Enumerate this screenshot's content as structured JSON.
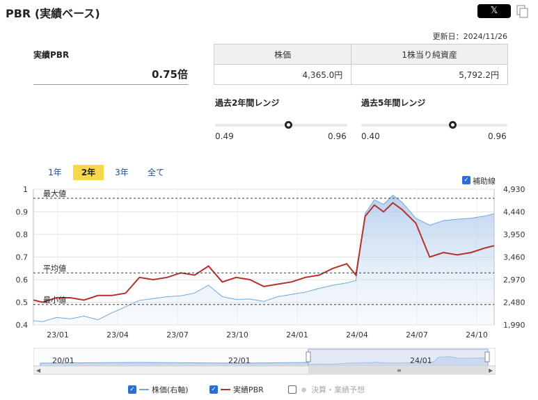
{
  "header": {
    "title": "PBR (実績ベース)",
    "share_label": "𝕏"
  },
  "updated": "更新日：2024/11/26",
  "pbr": {
    "label": "実績PBR",
    "value": "0.75倍"
  },
  "price_table": {
    "headers": [
      "株価",
      "1株当り純資産"
    ],
    "values": [
      "4,365.0円",
      "5,792.2円"
    ]
  },
  "ranges": [
    {
      "title": "過去2年間レンジ",
      "min": "0.49",
      "max": "0.96",
      "position": 0.55
    },
    {
      "title": "過去5年間レンジ",
      "min": "0.40",
      "max": "0.96",
      "position": 0.625
    }
  ],
  "tabs": [
    "1年",
    "2年",
    "3年",
    "全て"
  ],
  "active_tab": "2年",
  "aux_lines": {
    "label": "補助線",
    "checked": true
  },
  "ref_lines": {
    "max_label": "最大値",
    "avg_label": "平均値",
    "min_label": "最小値"
  },
  "navigator": {
    "labels": [
      "20/01",
      "22/01",
      "24/01"
    ]
  },
  "legend": [
    {
      "label": "株価(右軸)",
      "checked": true,
      "color": "#6ea8dc"
    },
    {
      "label": "実績PBR",
      "checked": true,
      "color": "#b5302a"
    },
    {
      "label": "決算・業績予想",
      "checked": false,
      "color": "#bbbbbb"
    }
  ],
  "chart_data": {
    "type": "line",
    "x_ticks": [
      "23/01",
      "23/04",
      "23/07",
      "23/10",
      "24/01",
      "24/04",
      "24/07",
      "24/10"
    ],
    "y_left_ticks": [
      "0.4",
      "0.5",
      "0.6",
      "0.7",
      "0.8",
      "0.9",
      "1"
    ],
    "y_right_ticks": [
      "1,990",
      "2,480",
      "2,970",
      "3,460",
      "3,950",
      "4,440",
      "4,930"
    ],
    "ylim_left": [
      0.4,
      1.0
    ],
    "ylim_right": [
      1990,
      4930
    ],
    "reference_lines": {
      "max": 0.96,
      "avg": 0.63,
      "min": 0.49
    },
    "series": [
      {
        "name": "実績PBR",
        "axis": "left",
        "color": "#b5302a",
        "x": [
          0,
          2,
          5,
          8,
          11,
          14,
          17,
          20,
          23,
          26,
          29,
          32,
          35,
          38,
          41,
          44,
          47,
          50,
          53,
          56,
          59,
          62,
          65,
          68,
          70,
          72,
          74,
          76,
          78,
          80,
          83,
          86,
          89,
          92,
          95,
          98,
          100
        ],
        "values": [
          0.51,
          0.5,
          0.52,
          0.52,
          0.51,
          0.53,
          0.53,
          0.54,
          0.61,
          0.6,
          0.61,
          0.63,
          0.62,
          0.66,
          0.59,
          0.61,
          0.6,
          0.57,
          0.58,
          0.59,
          0.61,
          0.62,
          0.65,
          0.67,
          0.62,
          0.88,
          0.93,
          0.9,
          0.94,
          0.91,
          0.85,
          0.7,
          0.72,
          0.71,
          0.72,
          0.74,
          0.75
        ]
      },
      {
        "name": "株価(右軸)",
        "axis": "right",
        "color": "#6ea8dc",
        "x": [
          0,
          2,
          5,
          8,
          11,
          14,
          17,
          20,
          23,
          26,
          29,
          32,
          35,
          38,
          41,
          44,
          47,
          50,
          53,
          56,
          59,
          62,
          65,
          68,
          70,
          72,
          74,
          76,
          78,
          80,
          83,
          86,
          89,
          92,
          95,
          98,
          100
        ],
        "values": [
          2080,
          2060,
          2150,
          2120,
          2180,
          2100,
          2250,
          2380,
          2520,
          2560,
          2600,
          2620,
          2680,
          2850,
          2600,
          2540,
          2550,
          2500,
          2600,
          2650,
          2700,
          2780,
          2850,
          2900,
          2950,
          4400,
          4700,
          4600,
          4800,
          4650,
          4300,
          4150,
          4250,
          4280,
          4300,
          4350,
          4400
        ]
      }
    ]
  }
}
